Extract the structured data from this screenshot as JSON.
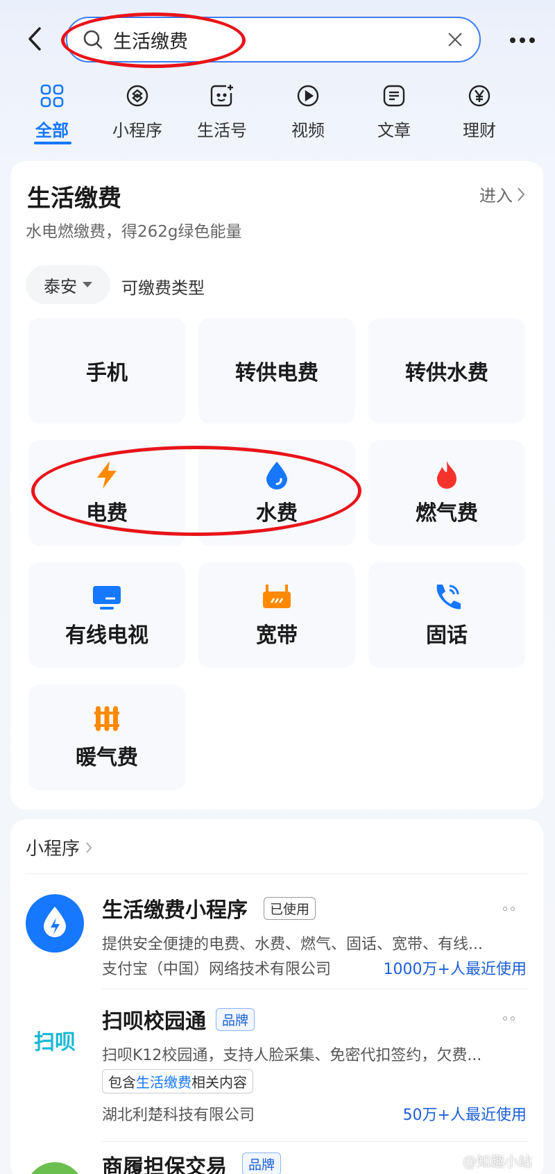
{
  "search": {
    "query": "生活缴费",
    "back_icon": "chevron-left-icon",
    "search_icon": "search-icon",
    "clear_icon": "close-icon",
    "more_icon": "more-horizontal-icon"
  },
  "tabs": [
    {
      "label": "全部",
      "icon": "grid-icon",
      "active": true
    },
    {
      "label": "小程序",
      "icon": "mini-program-icon",
      "active": false
    },
    {
      "label": "生活号",
      "icon": "life-account-icon",
      "active": false
    },
    {
      "label": "视频",
      "icon": "play-icon",
      "active": false
    },
    {
      "label": "文章",
      "icon": "article-icon",
      "active": false
    },
    {
      "label": "理财",
      "icon": "yen-icon",
      "active": false
    }
  ],
  "service_card": {
    "title": "生活缴费",
    "subtitle": "水电燃缴费，得262g绿色能量",
    "enter_label": "进入",
    "city": "泰安",
    "types_label": "可缴费类型",
    "items": [
      {
        "label": "手机",
        "icon": ""
      },
      {
        "label": "转供电费",
        "icon": ""
      },
      {
        "label": "转供水费",
        "icon": ""
      },
      {
        "label": "电费",
        "icon": "lightning-icon"
      },
      {
        "label": "水费",
        "icon": "water-drop-icon"
      },
      {
        "label": "燃气费",
        "icon": "flame-icon"
      },
      {
        "label": "有线电视",
        "icon": "tv-icon"
      },
      {
        "label": "宽带",
        "icon": "router-icon"
      },
      {
        "label": "固话",
        "icon": "phone-icon"
      },
      {
        "label": "暖气费",
        "icon": "radiator-icon"
      }
    ],
    "accent_colors": {
      "orange": "#ff8a00",
      "blue": "#1677ff",
      "red": "#f5332c"
    }
  },
  "mini_programs": {
    "header": "小程序",
    "apps": [
      {
        "name": "生活缴费小程序",
        "badge": "已使用",
        "description": "提供安全便捷的电费、水费、燃气、固话、宽带、有线...",
        "company": "支付宝（中国）网络技术有限公司",
        "usage": "1000万+人最近使用"
      },
      {
        "name": "扫呗校园通",
        "badge": "品牌",
        "logo_text": "扫呗",
        "description": "扫呗K12校园通，支持人脸采集、免密代扣签约，欠费...",
        "related_prefix": "包含",
        "related_highlight": "生活缴费",
        "related_suffix": "相关内容",
        "company": "湖北利楚科技有限公司",
        "usage": "50万+人最近使用"
      },
      {
        "name": "商履担保交易",
        "badge": "品牌"
      }
    ]
  },
  "watermark": "@知趣小站",
  "highlight_color": "#e8141a"
}
